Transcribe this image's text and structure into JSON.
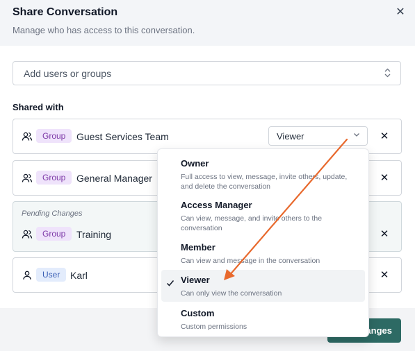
{
  "dialog": {
    "title": "Share Conversation",
    "subtitle": "Manage who has access to this conversation.",
    "close_icon": "close-icon"
  },
  "add_field": {
    "placeholder": "Add users or groups",
    "icon": "chevron-updown-icon"
  },
  "shared_with": {
    "label": "Shared with",
    "rows": [
      {
        "type": "Group",
        "name": "Guest Services Team",
        "role": "Viewer",
        "icon": "group-icon"
      },
      {
        "type": "Group",
        "name": "General Manager",
        "icon": "group-icon"
      },
      {
        "pending_label": "Pending Changes",
        "type": "Group",
        "name": "Training",
        "icon": "group-icon"
      },
      {
        "type": "User",
        "name": "Karl",
        "icon": "user-icon"
      }
    ]
  },
  "role_menu": {
    "options": [
      {
        "title": "Owner",
        "description": "Full access to view, message, invite others, update, and delete the conversation"
      },
      {
        "title": "Access Manager",
        "description": "Can view, message, and invite others to the conversation"
      },
      {
        "title": "Member",
        "description": "Can view and message in the conversation"
      },
      {
        "title": "Viewer",
        "description": "Can only view the conversation",
        "selected": true
      },
      {
        "title": "Custom",
        "description": "Custom permissions"
      }
    ]
  },
  "footer": {
    "save_label": "anges"
  },
  "colors": {
    "group_badge_bg": "#efe3fb",
    "group_badge_text": "#7e3aa8",
    "user_badge_bg": "#e3ecfc",
    "user_badge_text": "#3b5fb4",
    "primary_button": "#2d6a64",
    "annotation_arrow": "#e8692d"
  }
}
